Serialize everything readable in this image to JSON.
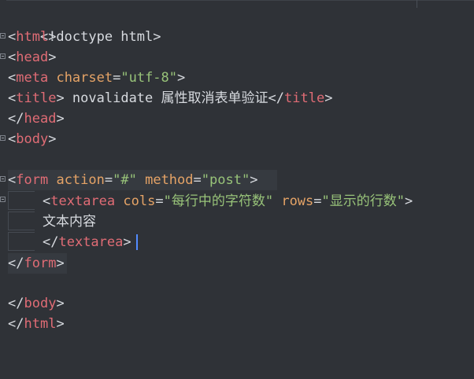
{
  "code": {
    "l1": {
      "text": "<!doctype html>"
    },
    "l2": {
      "open": "<",
      "tag": "html",
      "close": ">"
    },
    "l3": {
      "open": "<",
      "tag": "head",
      "close": ">"
    },
    "l4": {
      "open": "<",
      "tag": "meta",
      "attr": "charset",
      "eq": "=",
      "val": "\"utf-8\"",
      "close": ">"
    },
    "l5": {
      "open": "<",
      "tag": "title",
      "close": ">",
      "text": " novalidate 属性取消表单验证",
      "end_open": "</",
      "end_tag": "title",
      "end_close": ">"
    },
    "l6": {
      "open": "</",
      "tag": "head",
      "close": ">"
    },
    "l7": {
      "open": "<",
      "tag": "body",
      "close": ">"
    },
    "l9": {
      "open": "<",
      "tag": "form",
      "attr1": "action",
      "eq": "=",
      "val1": "\"#\"",
      "attr2": "method",
      "val2": "\"post\"",
      "close": ">"
    },
    "l10": {
      "open": "<",
      "tag": "textarea",
      "attr1": "cols",
      "eq": "=",
      "val1": "\"每行中的字符数\"",
      "attr2": "rows",
      "val2": "\"显示的行数\"",
      "close": ">"
    },
    "l11": {
      "text": "文本内容"
    },
    "l12": {
      "open": "</",
      "tag": "textarea",
      "close": ">"
    },
    "l13": {
      "open": "</",
      "tag": "form",
      "close": ">"
    },
    "l15": {
      "open": "</",
      "tag": "body",
      "close": ">"
    },
    "l16": {
      "open": "</",
      "tag": "html",
      "close": ">"
    }
  },
  "colors": {
    "background": "#2f3237",
    "tag": "#e06c75",
    "attribute": "#e5a366",
    "string": "#98c379",
    "text": "#d7dadf",
    "cursor": "#528bff"
  }
}
